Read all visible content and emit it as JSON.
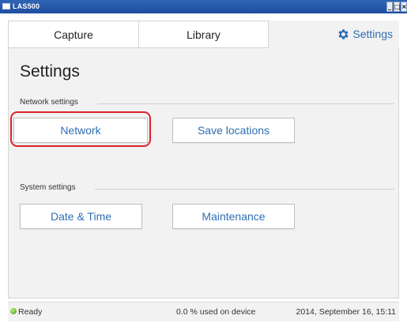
{
  "window": {
    "title": "LAS500",
    "controls": {
      "minimize": "_",
      "maximize": "□",
      "close": "×"
    }
  },
  "tabs": [
    {
      "label": "Capture",
      "selected": false
    },
    {
      "label": "Library",
      "selected": false
    },
    {
      "label": "Settings",
      "selected": true,
      "icon": "gear-icon"
    }
  ],
  "page": {
    "title": "Settings"
  },
  "sections": [
    {
      "label": "Network settings",
      "buttons": [
        "Network",
        "Save locations"
      ]
    },
    {
      "label": "System settings",
      "buttons": [
        "Date & Time",
        "Maintenance"
      ]
    }
  ],
  "status": {
    "state": "Ready",
    "usage": "0.0 % used on device",
    "datetime": "2014, September 16, 15:11"
  },
  "colors": {
    "accent": "#2f6fb3",
    "highlight": "#d8232a",
    "titlebar": "#2457a8",
    "status_ok": "#5cbf2a"
  }
}
